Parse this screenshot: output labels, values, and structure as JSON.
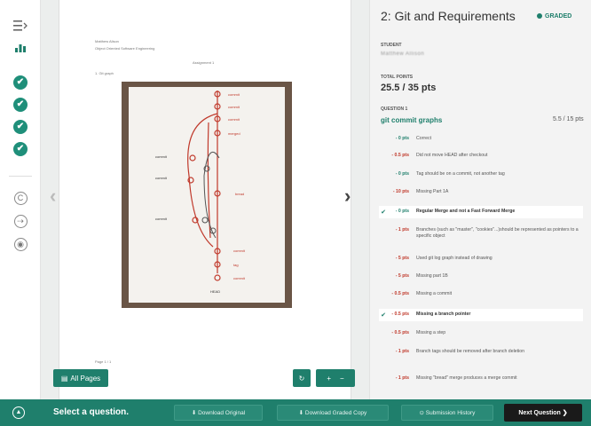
{
  "rail": {
    "menu_icon": "collapse-menu-icon",
    "chart_icon": "bar-chart-icon",
    "checks": [
      "✔",
      "✔",
      "✔",
      "✔"
    ],
    "ungraded": [
      "C",
      "⇢",
      "◉"
    ]
  },
  "document": {
    "header_lines": [
      "Matthew Alison",
      "Object Oriented Software Engineering"
    ],
    "assignment": "Assignment 1",
    "item": "1. Git graph",
    "page_label": "Page 1 / 1"
  },
  "toolbar": {
    "all_pages": "All Pages",
    "rotate": "↻",
    "zoom_in": "+",
    "zoom_out": "−"
  },
  "panel": {
    "title": "2: Git and Requirements",
    "status": "GRADED",
    "student_label": "STUDENT",
    "student_name": "Matthew Allison",
    "total_label": "TOTAL POINTS",
    "total_value": "25.5 / 35 pts",
    "question_label": "QUESTION 1",
    "question_name": "git commit graphs",
    "question_points": "5.5 / 15 pts",
    "rubric": [
      {
        "pts": "- 0 pts",
        "desc": "Correct",
        "selected": false
      },
      {
        "pts": "- 0.5 pts",
        "desc": "Did not move HEAD after checkout",
        "selected": false
      },
      {
        "pts": "- 0 pts",
        "desc": "Tag should be on a commit, not another tag",
        "selected": false
      },
      {
        "pts": "- 10 pts",
        "desc": "Missing Part 1A",
        "selected": false
      },
      {
        "pts": "- 0 pts",
        "desc": "Regular Merge and not a Fast Forward Merge",
        "selected": true
      },
      {
        "pts": "- 1 pts",
        "desc": "Branches (such as \"master\", \"cookies\"...)should be represented as pointers to a specific object",
        "selected": false
      },
      {
        "pts": "- 5 pts",
        "desc": "Used git log graph instead of drawing",
        "selected": false
      },
      {
        "pts": "- 5 pts",
        "desc": "Missing part 1B",
        "selected": false
      },
      {
        "pts": "- 0.5 pts",
        "desc": "Missing a commit",
        "selected": false
      },
      {
        "pts": "- 0.5 pts",
        "desc": "Missing a branch pointer",
        "selected": true
      },
      {
        "pts": "- 0.5 pts",
        "desc": "Missing a step",
        "selected": false
      },
      {
        "pts": "- 1 pts",
        "desc": "Branch tags should be removed after branch deletion",
        "selected": false
      },
      {
        "pts": "- 1 pts",
        "desc": "Missing \"bread\" merge produces a merge commit",
        "selected": false
      }
    ]
  },
  "bottom": {
    "prompt": "Select a question.",
    "download_original": "⬇ Download Original",
    "download_graded": "⬇ Download Graded Copy",
    "history": "⊙ Submission History",
    "next": "Next Question ❯"
  },
  "colors": {
    "accent": "#1f7f6c",
    "deduction": "#c0392b",
    "next_button": "#1a1a1a"
  }
}
